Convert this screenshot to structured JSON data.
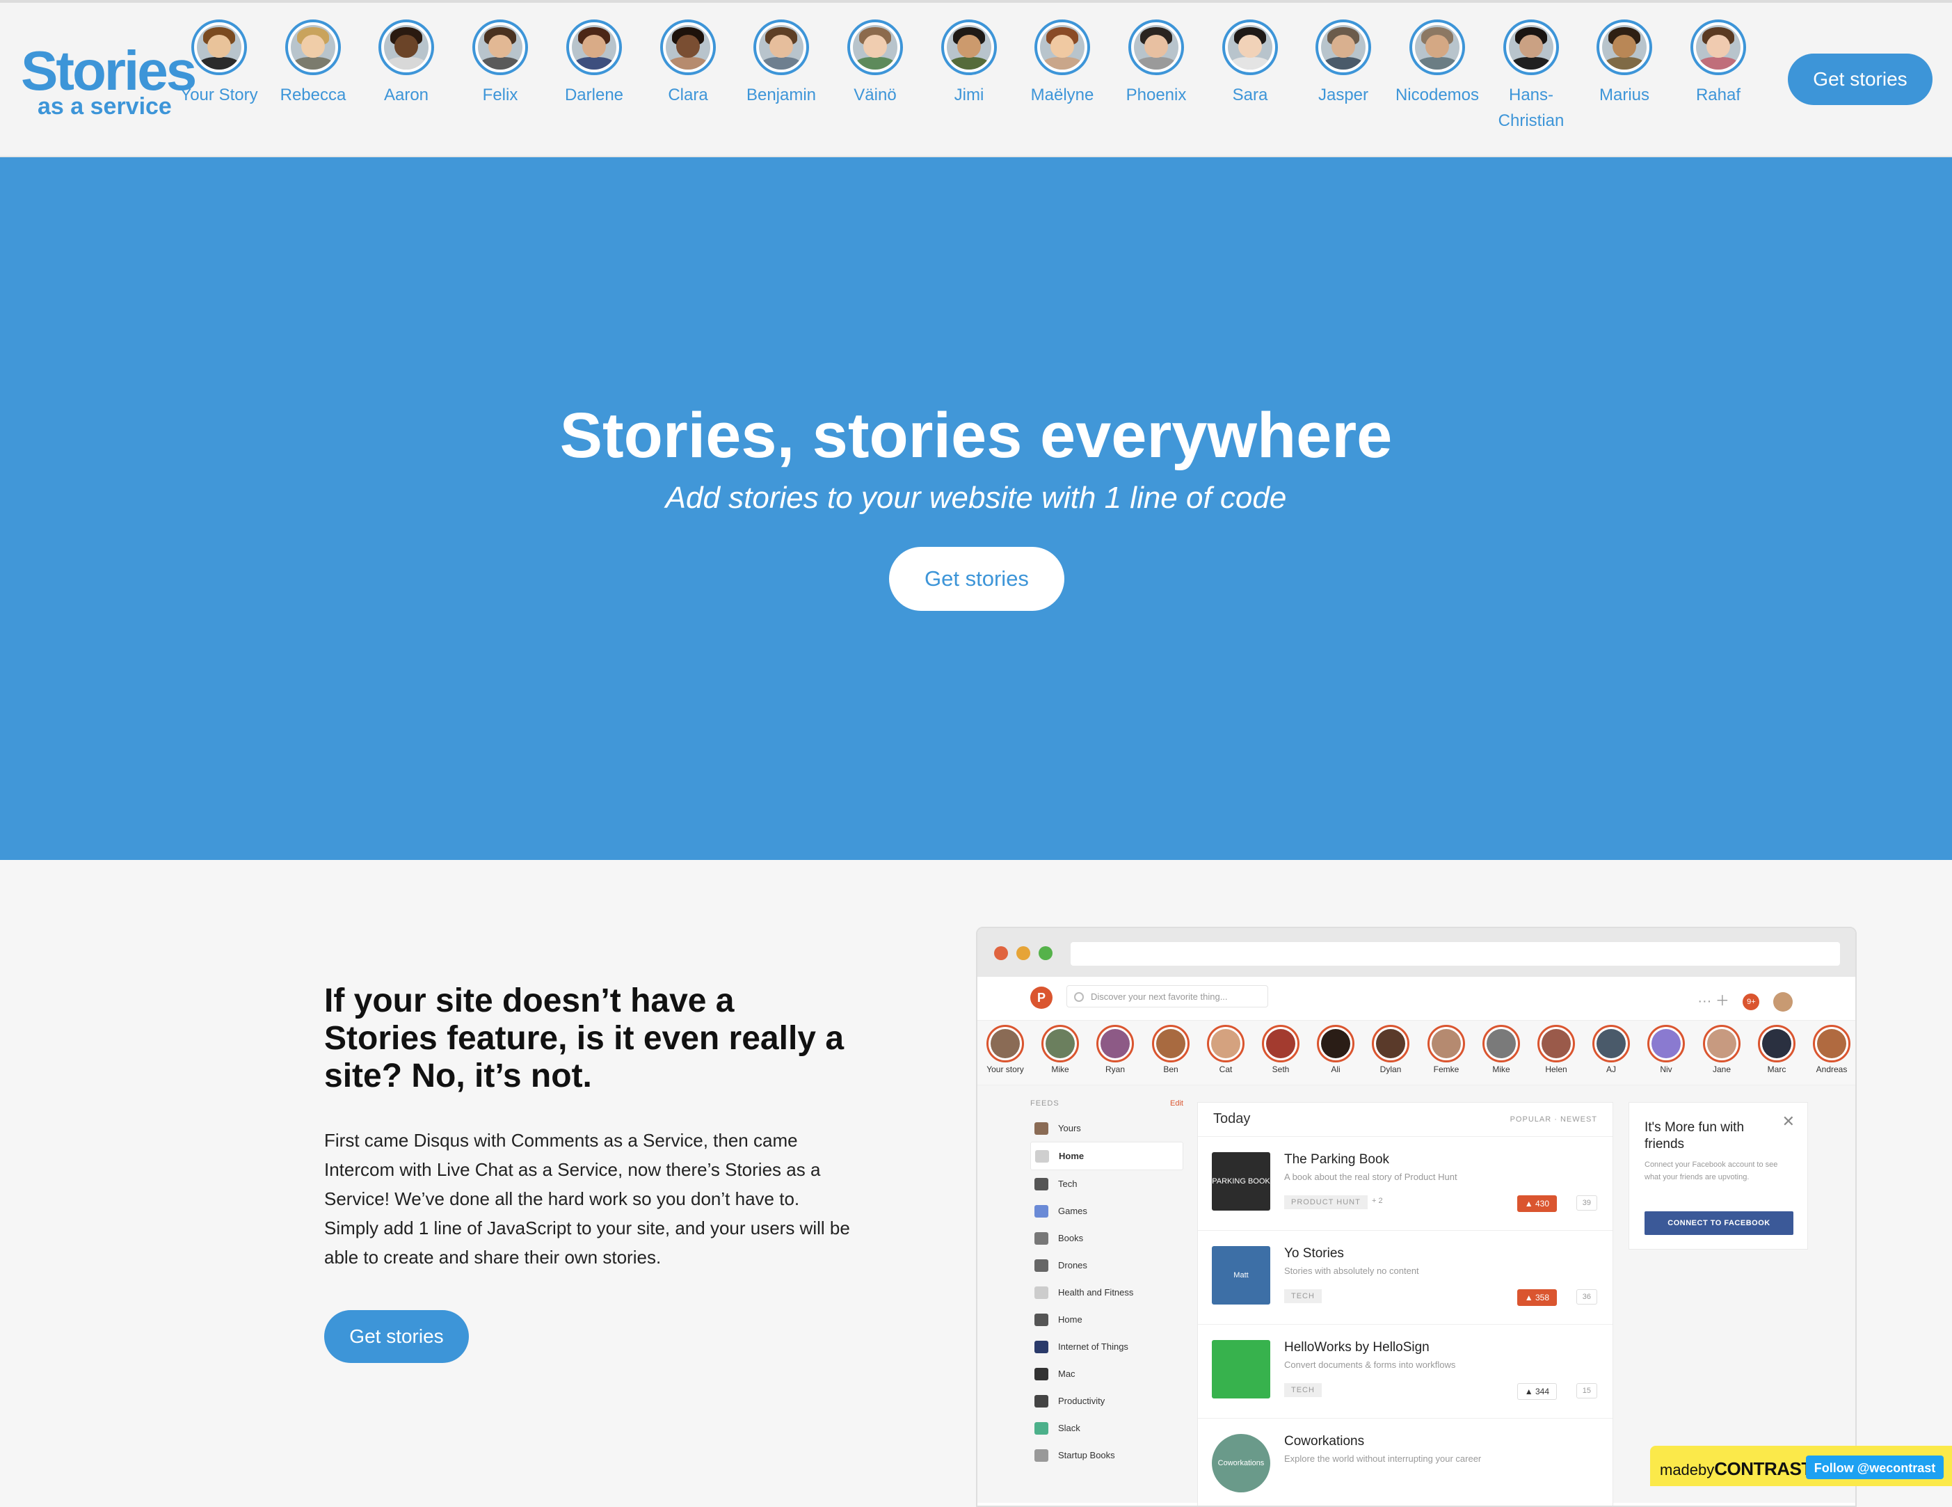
{
  "logo": {
    "main": "Stories",
    "sub": "as a service"
  },
  "top_stories": [
    {
      "label": "Your Story",
      "skin": "#e9c39a",
      "hair": "#7a4a20",
      "shirt": "#2b2b2b"
    },
    {
      "label": "Rebecca",
      "skin": "#f0cda8",
      "hair": "#c9a35c",
      "shirt": "#7b7b6d"
    },
    {
      "label": "Aaron",
      "skin": "#6b4428",
      "hair": "#2a1a10",
      "shirt": "#d8d8d8"
    },
    {
      "label": "Felix",
      "skin": "#e2b894",
      "hair": "#4a3220",
      "shirt": "#5a5a5a"
    },
    {
      "label": "Darlene",
      "skin": "#d9ab87",
      "hair": "#4b2616",
      "shirt": "#3d4f7e"
    },
    {
      "label": "Clara",
      "skin": "#7a4e32",
      "hair": "#1d120b",
      "shirt": "#b68b6e"
    },
    {
      "label": "Benjamin",
      "skin": "#e6be9c",
      "hair": "#5e3f25",
      "shirt": "#6e7f8f"
    },
    {
      "label": "Väinö",
      "skin": "#f0cdb0",
      "hair": "#8c6a4c",
      "shirt": "#5d8a5b"
    },
    {
      "label": "Jimi",
      "skin": "#cc9a6d",
      "hair": "#1f1a16",
      "shirt": "#556b3a"
    },
    {
      "label": "Maëlyne",
      "skin": "#f0c9a2",
      "hair": "#8a4b26",
      "shirt": "#c9a68a"
    },
    {
      "label": "Phoenix",
      "skin": "#e8c0a1",
      "hair": "#2a2420",
      "shirt": "#9a9a9a"
    },
    {
      "label": "Sara",
      "skin": "#f1d2b8",
      "hair": "#1f1a17",
      "shirt": "#e4e4e4"
    },
    {
      "label": "Jasper",
      "skin": "#d9b08f",
      "hair": "#6b5b4b",
      "shirt": "#4a5a6a"
    },
    {
      "label": "Nicodemos",
      "skin": "#d4a884",
      "hair": "#8c7863",
      "shirt": "#6b7d84"
    },
    {
      "label": "Hans-Christian",
      "skin": "#caa183",
      "hair": "#1a1512",
      "shirt": "#202020"
    },
    {
      "label": "Marius",
      "skin": "#b98756",
      "hair": "#2e1f13",
      "shirt": "#7f6a46"
    },
    {
      "label": "Rahaf",
      "skin": "#f0cbb0",
      "hair": "#5a3a22",
      "shirt": "#c06e7a"
    }
  ],
  "top_button": "Get stories",
  "hero": {
    "title": "Stories, stories everywhere",
    "subtitle": "Add stories to your website with 1 line of code",
    "button": "Get stories"
  },
  "content": {
    "heading": "If your site doesn’t have a Stories feature, is it even really a site? No, it’s not.",
    "body": "First came Disqus with Comments as a Service, then came Intercom with Live Chat as a Service, now there’s Stories as a Service! We’ve done all the hard work so you don’t have to. Simply add 1 line of JavaScript to your site, and your users will be able to create and share their own stories.",
    "button": "Get stories"
  },
  "mockup": {
    "dots": [
      "#e0643f",
      "#e6a437",
      "#55b24a"
    ],
    "logo_letter": "P",
    "search_placeholder": "Discover your next favorite thing...",
    "nav_icons": "··· ＋",
    "notif_badge": "9+",
    "stories": [
      {
        "label": "Your story",
        "c": "#8a6b55"
      },
      {
        "label": "Mike",
        "c": "#6b7f5e"
      },
      {
        "label": "Ryan",
        "c": "#8d5a86"
      },
      {
        "label": "Ben",
        "c": "#a86a40"
      },
      {
        "label": "Cat",
        "c": "#d4a27f"
      },
      {
        "label": "Seth",
        "c": "#a33b2f"
      },
      {
        "label": "Ali",
        "c": "#2a1d16"
      },
      {
        "label": "Dylan",
        "c": "#5a3a2a"
      },
      {
        "label": "Femke",
        "c": "#b58a70"
      },
      {
        "label": "Mike",
        "c": "#7a7a7a"
      },
      {
        "label": "Helen",
        "c": "#9a5a4a"
      },
      {
        "label": "AJ",
        "c": "#4a5a6a"
      },
      {
        "label": "Niv",
        "c": "#8a7ad0"
      },
      {
        "label": "Jane",
        "c": "#c79a80"
      },
      {
        "label": "Marc",
        "c": "#2a3040"
      },
      {
        "label": "Andreas",
        "c": "#b06a40"
      }
    ],
    "feeds_header": "FEEDS",
    "feeds_edit": "Edit",
    "feeds": [
      {
        "label": "Yours",
        "c": "#8a6b55"
      },
      {
        "label": "Home",
        "c": "#cfcfcf"
      },
      {
        "label": "Tech",
        "c": "#555"
      },
      {
        "label": "Games",
        "c": "#6a8ad6"
      },
      {
        "label": "Books",
        "c": "#777"
      },
      {
        "label": "Drones",
        "c": "#666"
      },
      {
        "label": "Health and Fitness",
        "c": "#ccc"
      },
      {
        "label": "Home",
        "c": "#555"
      },
      {
        "label": "Internet of Things",
        "c": "#2a3a6a"
      },
      {
        "label": "Mac",
        "c": "#333"
      },
      {
        "label": "Productivity",
        "c": "#444"
      },
      {
        "label": "Slack",
        "c": "#4cb08a"
      },
      {
        "label": "Startup Books",
        "c": "#999"
      }
    ],
    "posts_title": "Today",
    "posts_tabs": "POPULAR · NEWEST",
    "posts": [
      {
        "title": "The Parking Book",
        "desc": "A book about the real story of Product Hunt",
        "tag": "PRODUCT HUNT",
        "extra": "+ 2",
        "votes": "▲ 430",
        "comments": "39",
        "upvoted": true,
        "thumb": "#2c2c2c",
        "thumb_label": "PARKING BOOK"
      },
      {
        "title": "Yo Stories",
        "desc": "Stories with absolutely no content",
        "tag": "TECH",
        "extra": "",
        "votes": "▲ 358",
        "comments": "36",
        "upvoted": true,
        "thumb": "#3d6fa6",
        "thumb_label": "Matt"
      },
      {
        "title": "HelloWorks by HelloSign",
        "desc": "Convert documents & forms into workflows",
        "tag": "TECH",
        "extra": "",
        "votes": "▲ 344",
        "comments": "15",
        "upvoted": false,
        "thumb": "#37b24d",
        "thumb_label": ""
      },
      {
        "title": "Coworkations",
        "desc": "Explore the world without interrupting your career",
        "tag": "",
        "extra": "",
        "votes": "",
        "comments": "",
        "upvoted": false,
        "thumb": "#6a9a8a",
        "thumb_label": "Coworkations"
      }
    ],
    "fb": {
      "title": "It's More fun with friends",
      "desc": "Connect your Facebook account to see what your friends are upvoting.",
      "button": "CONNECT TO FACEBOOK",
      "close": "✕"
    }
  },
  "badge": {
    "made_by": "madeby",
    "brand": "CONTRAST",
    "follow": "Follow @wecontrast"
  }
}
